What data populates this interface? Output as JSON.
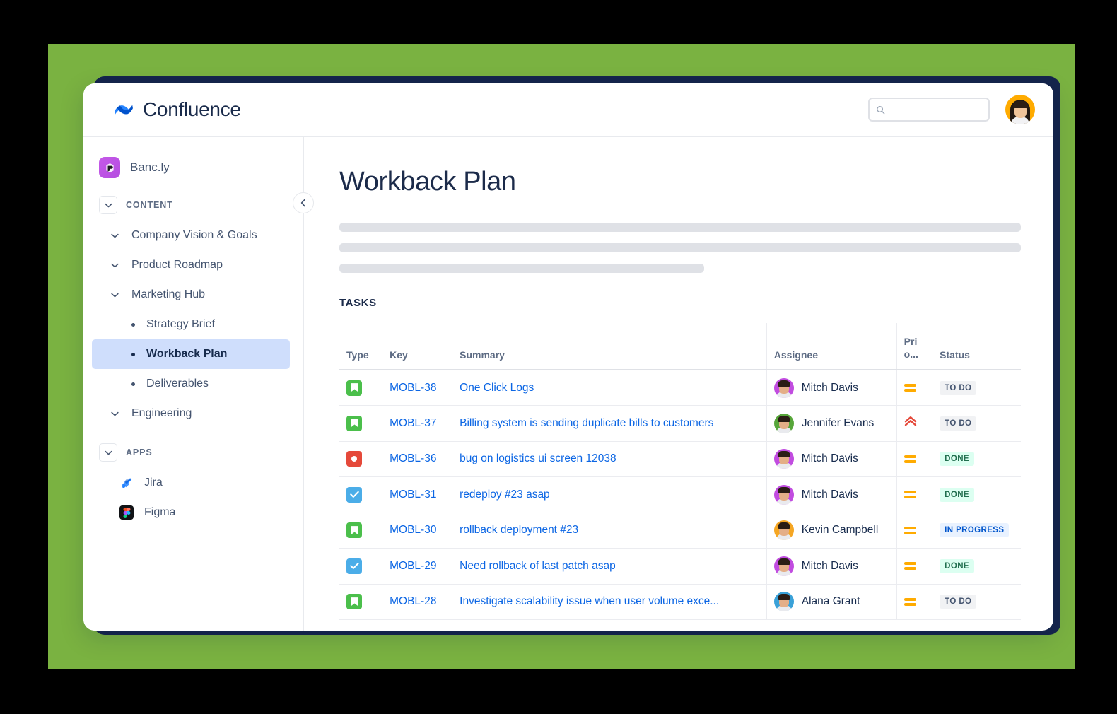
{
  "app": {
    "brand_name": "Confluence",
    "brand_logo_icon": "confluence-logo-icon"
  },
  "topbar": {
    "search_placeholder": "",
    "search_value": "",
    "search_icon": "search-icon",
    "avatar_icon": "user-avatar"
  },
  "sidebar": {
    "space": {
      "name": "Banc.ly",
      "logo_icon": "bancly-space-logo"
    },
    "content_section": {
      "label": "CONTENT",
      "chevron_icon": "chevron-down-icon",
      "items": [
        {
          "label": "Company Vision & Goals",
          "chevron_icon": "chevron-down-icon"
        },
        {
          "label": "Product Roadmap",
          "chevron_icon": "chevron-down-icon"
        },
        {
          "label": "Marketing Hub",
          "chevron_icon": "chevron-down-icon"
        }
      ],
      "children": [
        {
          "label": "Strategy Brief",
          "active": false
        },
        {
          "label": "Workback Plan",
          "active": true
        },
        {
          "label": "Deliverables",
          "active": false
        }
      ],
      "last_item": {
        "label": "Engineering",
        "chevron_icon": "chevron-down-icon"
      }
    },
    "apps_section": {
      "label": "APPS",
      "chevron_icon": "chevron-down-icon",
      "items": [
        {
          "label": "Jira",
          "icon": "jira-icon"
        },
        {
          "label": "Figma",
          "icon": "figma-icon"
        }
      ]
    },
    "collapse_button_icon": "chevron-left-icon"
  },
  "main": {
    "page_title": "Workback Plan",
    "tasks_heading": "TASKS",
    "table": {
      "columns": [
        "Type",
        "Key",
        "Summary",
        "Assignee",
        "Priority",
        "Status"
      ],
      "priority_header_line1": "Pri",
      "priority_header_line2": "o...",
      "rows": [
        {
          "type": "story",
          "key": "MOBL-38",
          "summary": "One Click Logs",
          "assignee": "Mitch Davis",
          "avatar_color": "#c14ce0",
          "priority": "medium",
          "status": "TO DO",
          "status_kind": "todo"
        },
        {
          "type": "story",
          "key": "MOBL-37",
          "summary": "Billing system is sending duplicate bills to customers",
          "assignee": "Jennifer Evans",
          "avatar_color": "#57a63a",
          "priority": "highest",
          "status": "TO DO",
          "status_kind": "todo"
        },
        {
          "type": "bug",
          "key": "MOBL-36",
          "summary": "bug on logistics ui screen 12038",
          "assignee": "Mitch Davis",
          "avatar_color": "#c14ce0",
          "priority": "medium",
          "status": "DONE",
          "status_kind": "done"
        },
        {
          "type": "task",
          "key": "MOBL-31",
          "summary": "redeploy #23 asap",
          "assignee": "Mitch Davis",
          "avatar_color": "#c14ce0",
          "priority": "medium",
          "status": "DONE",
          "status_kind": "done"
        },
        {
          "type": "story",
          "key": "MOBL-30",
          "summary": "rollback deployment #23",
          "assignee": "Kevin Campbell",
          "avatar_color": "#f5a623",
          "priority": "medium",
          "status": "IN PROGRESS",
          "status_kind": "progress"
        },
        {
          "type": "task",
          "key": "MOBL-29",
          "summary": "Need rollback of last patch asap",
          "assignee": "Mitch Davis",
          "avatar_color": "#c14ce0",
          "priority": "medium",
          "status": "DONE",
          "status_kind": "done"
        },
        {
          "type": "story",
          "key": "MOBL-28",
          "summary": "Investigate scalability issue when user volume exce...",
          "assignee": "Alana Grant",
          "avatar_color": "#3aa1d8",
          "priority": "medium",
          "status": "TO DO",
          "status_kind": "todo"
        }
      ]
    }
  },
  "colors": {
    "green_backdrop": "#7ab241",
    "navy_shadow": "#15254c",
    "link_blue": "#0c66e4",
    "active_nav": "#cfdefc",
    "priority_medium": "#ffab00",
    "priority_highest": "#e5493a"
  }
}
